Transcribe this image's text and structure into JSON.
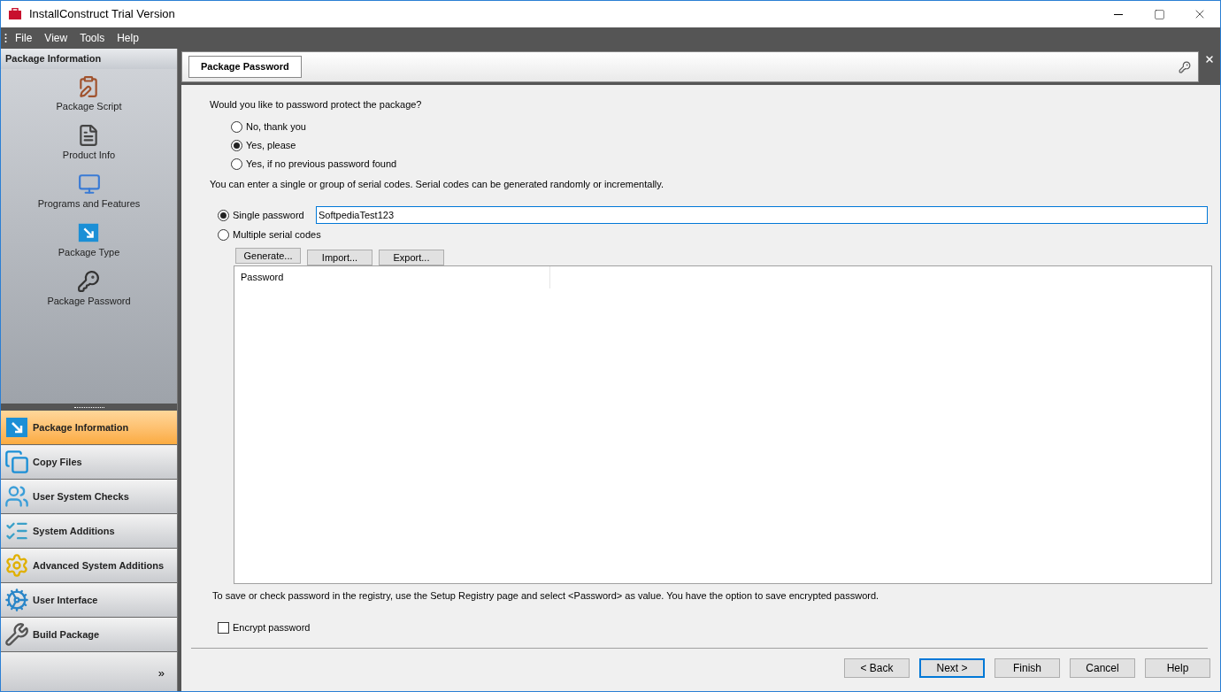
{
  "window": {
    "title": "InstallConstruct Trial Version"
  },
  "menu": [
    "File",
    "View",
    "Tools",
    "Help"
  ],
  "sidebar": {
    "header": "Package Information",
    "items": [
      {
        "label": "Package Script",
        "kind": "script"
      },
      {
        "label": "Product Info",
        "kind": "document"
      },
      {
        "label": "Programs and Features",
        "kind": "computer"
      },
      {
        "label": "Package Type",
        "kind": "package"
      },
      {
        "label": "Package Password",
        "kind": "key"
      }
    ],
    "nav": [
      {
        "label": "Package Information",
        "kind": "package",
        "selected": true
      },
      {
        "label": "Copy Files",
        "kind": "copy",
        "selected": false
      },
      {
        "label": "User System Checks",
        "kind": "users",
        "selected": false
      },
      {
        "label": "System Additions",
        "kind": "list",
        "selected": false
      },
      {
        "label": "Advanced System Additions",
        "kind": "gear",
        "selected": false
      },
      {
        "label": "User Interface",
        "kind": "gears",
        "selected": false
      },
      {
        "label": "Build Package",
        "kind": "tools",
        "selected": false
      }
    ],
    "more": "»"
  },
  "page": {
    "tab": "Package Password",
    "question": "Would you like to password protect the package?",
    "protect_options": [
      {
        "label": "No, thank you",
        "selected": false
      },
      {
        "label": "Yes, please",
        "selected": true
      },
      {
        "label": "Yes, if no previous password found",
        "selected": false
      }
    ],
    "note": "You can enter a single or group of serial codes.  Serial codes can be generated randomly or incrementally.",
    "mode_options": [
      {
        "label": "Single password",
        "selected": true
      },
      {
        "label": "Multiple serial codes",
        "selected": false
      }
    ],
    "password": {
      "value": "SoftpediaTest123"
    },
    "list_buttons": [
      "Generate...",
      "Import...",
      "Export..."
    ],
    "table": {
      "columns": [
        "Password"
      ]
    },
    "registry_note": "To save or check password in the registry, use the Setup Registry page and select <Password> as value.  You have the option to save encrypted password.",
    "encrypt": {
      "label": "Encrypt password",
      "checked": false
    },
    "buttons": [
      {
        "label": "< Back",
        "focused": false
      },
      {
        "label": "Next >",
        "focused": true
      },
      {
        "label": "Finish",
        "focused": false
      },
      {
        "label": "Cancel",
        "focused": false
      },
      {
        "label": "Help",
        "focused": false
      }
    ]
  }
}
